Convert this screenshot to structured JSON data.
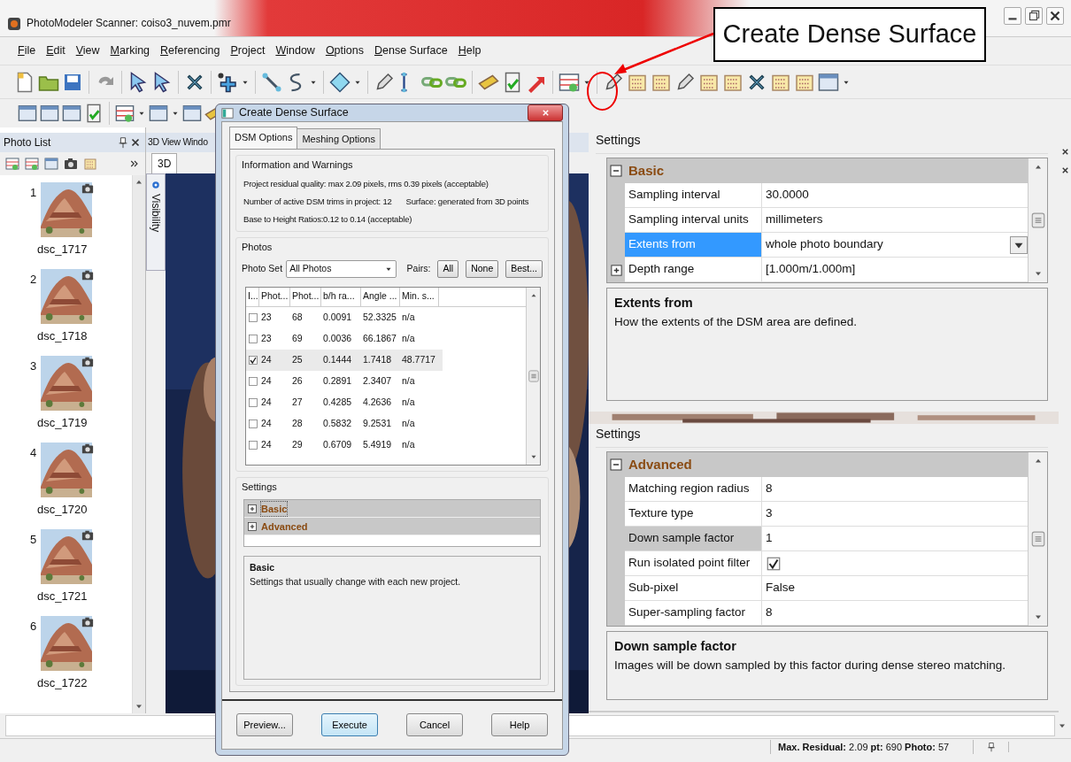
{
  "window": {
    "title": "PhotoModeler Scanner: coiso3_nuvem.pmr"
  },
  "menu": [
    {
      "label": "File"
    },
    {
      "label": "Edit"
    },
    {
      "label": "View"
    },
    {
      "label": "Marking"
    },
    {
      "label": "Referencing"
    },
    {
      "label": "Project"
    },
    {
      "label": "Window"
    },
    {
      "label": "Options"
    },
    {
      "label": "Dense Surface"
    },
    {
      "label": "Help"
    }
  ],
  "annotation": {
    "label": "Create Dense Surface"
  },
  "photo_list": {
    "title": "Photo List",
    "items": [
      {
        "number": "1",
        "label": "dsc_1717"
      },
      {
        "number": "2",
        "label": "dsc_1718"
      },
      {
        "number": "3",
        "label": "dsc_1719"
      },
      {
        "number": "4",
        "label": "dsc_1720"
      },
      {
        "number": "5",
        "label": "dsc_1721"
      },
      {
        "number": "6",
        "label": "dsc_1722"
      }
    ]
  },
  "view_3d": {
    "title": "3D View Windo",
    "tab": "3D",
    "side_tab": "Visibility"
  },
  "dialog": {
    "title": "Create Dense Surface",
    "tabs": [
      {
        "label": "DSM Options",
        "selected": true
      },
      {
        "label": "Meshing Options",
        "selected": false
      }
    ],
    "info": {
      "title": "Information and Warnings",
      "lines": [
        [
          "Project residual quality: max 2.09 pixels, rms 0.39 pixels (acceptable)"
        ],
        [
          "Number of active DSM trims in project: 12",
          "Surface: generated from 3D points"
        ],
        [
          "Base to Height Ratios:0.12 to 0.14 (acceptable)"
        ]
      ]
    },
    "photos": {
      "title": "Photos",
      "photo_set_label": "Photo Set",
      "photo_set": "All Photos",
      "pairs_label": "Pairs:",
      "pair_buttons": [
        "All",
        "None",
        "Best..."
      ],
      "check_column": "I...",
      "columns": [
        "Phot...",
        "Phot...",
        "b/h ra...",
        "Angle ...",
        "Min. s..."
      ],
      "rows": [
        {
          "checked": false,
          "selected": false,
          "cells": [
            "23",
            "68",
            "0.0091",
            "52.3325",
            "n/a"
          ]
        },
        {
          "checked": false,
          "selected": false,
          "cells": [
            "23",
            "69",
            "0.0036",
            "66.1867",
            "n/a"
          ]
        },
        {
          "checked": true,
          "selected": true,
          "cells": [
            "24",
            "25",
            "0.1444",
            "1.7418",
            "48.7717"
          ]
        },
        {
          "checked": false,
          "selected": false,
          "cells": [
            "24",
            "26",
            "0.2891",
            "2.3407",
            "n/a"
          ]
        },
        {
          "checked": false,
          "selected": false,
          "cells": [
            "24",
            "27",
            "0.4285",
            "4.2636",
            "n/a"
          ]
        },
        {
          "checked": false,
          "selected": false,
          "cells": [
            "24",
            "28",
            "0.5832",
            "9.2531",
            "n/a"
          ]
        },
        {
          "checked": false,
          "selected": false,
          "cells": [
            "24",
            "29",
            "0.6709",
            "5.4919",
            "n/a"
          ]
        }
      ]
    },
    "settings": {
      "title": "Settings",
      "categories": [
        {
          "label": "Basic",
          "expanded": false,
          "selected": true
        },
        {
          "label": "Advanced",
          "expanded": false,
          "selected": false
        }
      ],
      "description": {
        "title": "Basic",
        "text": "Settings that usually change with each new project."
      }
    },
    "buttons": [
      {
        "label": "Preview...",
        "default": false
      },
      {
        "label": "Execute",
        "default": true
      },
      {
        "label": "Cancel",
        "default": false
      },
      {
        "label": "Help",
        "default": false
      }
    ]
  },
  "settings_panels": [
    {
      "title": "Settings",
      "focused": true,
      "category": {
        "label": "Basic",
        "expanded": true
      },
      "rows": [
        {
          "kind": "text",
          "name": "Sampling interval",
          "value": "30.0000",
          "selected": false
        },
        {
          "kind": "text",
          "name": "Sampling interval units",
          "value": "millimeters",
          "selected": false
        },
        {
          "kind": "dropdown",
          "name": "Extents from",
          "value": "whole photo boundary",
          "selected": true
        },
        {
          "kind": "group",
          "name": "Depth range",
          "value": "[1.000m/1.000m]",
          "selected": false,
          "expanded": false
        }
      ],
      "description": {
        "title": "Extents from",
        "text": "How the extents of the DSM area are defined."
      }
    },
    {
      "title": "Settings",
      "focused": false,
      "category": {
        "label": "Advanced",
        "expanded": true
      },
      "rows": [
        {
          "kind": "text",
          "name": "Matching region radius",
          "value": "8",
          "selected": false
        },
        {
          "kind": "text",
          "name": "Texture type",
          "value": "3",
          "selected": false
        },
        {
          "kind": "text",
          "name": "Down sample factor",
          "value": "1",
          "selected": true
        },
        {
          "kind": "checkbox",
          "name": "Run isolated point filter",
          "checked": true,
          "selected": false
        },
        {
          "kind": "text",
          "name": "Sub-pixel",
          "value": "False",
          "selected": false
        },
        {
          "kind": "text",
          "name": "Super-sampling factor",
          "value": "8",
          "selected": false
        }
      ],
      "description": {
        "title": "Down sample factor",
        "text": "Images will be down sampled by this factor during dense stereo matching."
      }
    }
  ],
  "status_bar": {
    "text": "**Max. Residual:** 2.09 **pt:** 690 **Photo:** 57"
  }
}
